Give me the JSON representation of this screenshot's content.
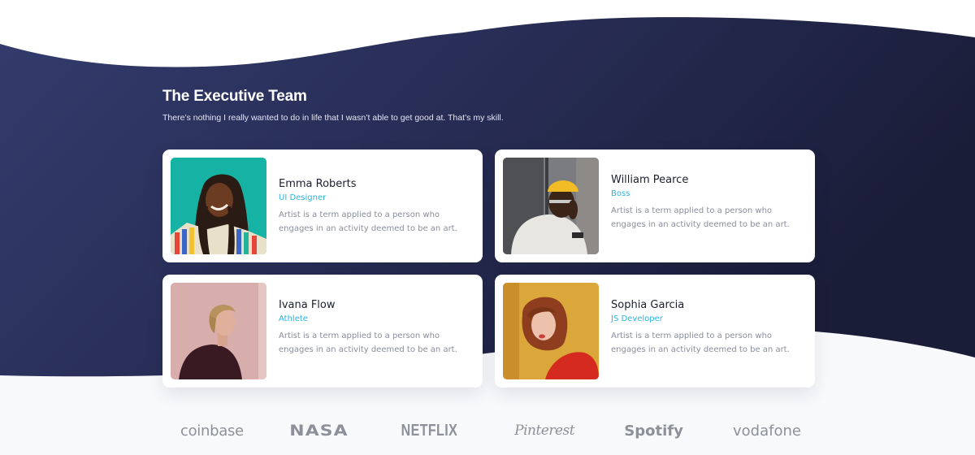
{
  "section": {
    "title": "The Executive Team",
    "subtitle": "There’s nothing I really wanted to do in life that I wasn’t able to get good at. That’s my skill."
  },
  "colors": {
    "wave_dark_left": "#323a6a",
    "wave_dark_right": "#1c1f3c",
    "role_accent": "#2ab3dd",
    "name_text": "#1c1f2e",
    "desc_text": "#8a8d9c",
    "logo_gray": "#8e9099",
    "page_bg": "#f8f9fb"
  },
  "team": [
    {
      "name": "Emma Roberts",
      "role": "UI Designer",
      "description": "Artist is a term applied to a person who engages in an activity deemed to be an art.",
      "photo": "portrait-woman-teal-background"
    },
    {
      "name": "William Pearce",
      "role": "Boss",
      "description": "Artist is a term applied to a person who engages in an activity deemed to be an art.",
      "photo": "portrait-man-yellow-beanie"
    },
    {
      "name": "Ivana Flow",
      "role": "Athlete",
      "description": "Artist is a term applied to a person who engages in an activity deemed to be an art.",
      "photo": "portrait-man-pink-background"
    },
    {
      "name": "Sophia Garcia",
      "role": "JS Developer",
      "description": "Artist is a term applied to a person who engages in an activity deemed to be an art.",
      "photo": "portrait-woman-yellow-background"
    }
  ],
  "logos": [
    "coinbase",
    "NASA",
    "NETFLIX",
    "Pinterest",
    "Spotify",
    "vodafone"
  ]
}
